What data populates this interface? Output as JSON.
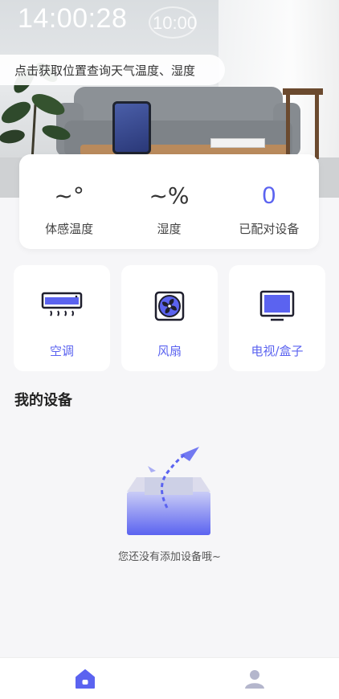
{
  "status": {
    "time": "14:00:28",
    "clock_overlay": "10:00"
  },
  "location": {
    "prompt": "点击获取位置查询天气温度、湿度"
  },
  "stats": [
    {
      "value": "~°",
      "label": "体感温度"
    },
    {
      "value": "~%",
      "label": "湿度"
    },
    {
      "value": "0",
      "label": "已配对设备"
    }
  ],
  "categories": [
    {
      "label": "空调",
      "icon": "air-conditioner-icon"
    },
    {
      "label": "风扇",
      "icon": "fan-icon"
    },
    {
      "label": "电视/盒子",
      "icon": "tv-icon"
    }
  ],
  "my_devices": {
    "title": "我的设备",
    "empty_text": "您还没有添加设备哦~"
  },
  "nav": {
    "items": [
      {
        "icon": "home-icon",
        "active": true
      },
      {
        "icon": "profile-icon",
        "active": false
      }
    ]
  },
  "colors": {
    "accent": "#5b63f0",
    "nav_inactive": "#b4b6cc"
  }
}
